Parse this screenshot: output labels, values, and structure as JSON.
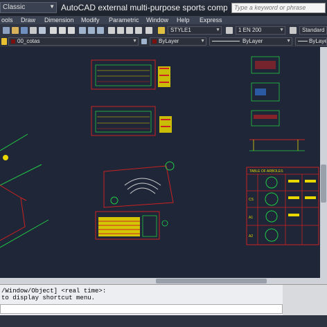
{
  "titlebar": {
    "workspace": "Classic",
    "title": "AutoCAD external multi-purpose sports complex pla...",
    "search_placeholder": "Type a keyword or phrase"
  },
  "menu": {
    "items": [
      "ools",
      "Draw",
      "Dimension",
      "Modify",
      "Parametric",
      "Window",
      "Help",
      "Express"
    ]
  },
  "toolbar": {
    "text_style": "STYLE1",
    "dim_style": "1 EN 200",
    "table_style": "Standard"
  },
  "layers": {
    "current_layer": "00_cotas",
    "color": "ByLayer",
    "linetype": "ByLayer",
    "lineweight": "ByLayer"
  },
  "drawing": {
    "legend_title": "TABLE OF ARBOLES",
    "legend_row_labels": [
      "CS",
      "A1",
      "A2"
    ]
  },
  "command": {
    "line1": "/Window/Object] <real time>:",
    "line2": " to display shortcut menu."
  },
  "colors": {
    "canvas": "#1e2638",
    "accent_red": "#cc2222",
    "accent_yellow": "#e8d800",
    "accent_green": "#22cc44"
  }
}
